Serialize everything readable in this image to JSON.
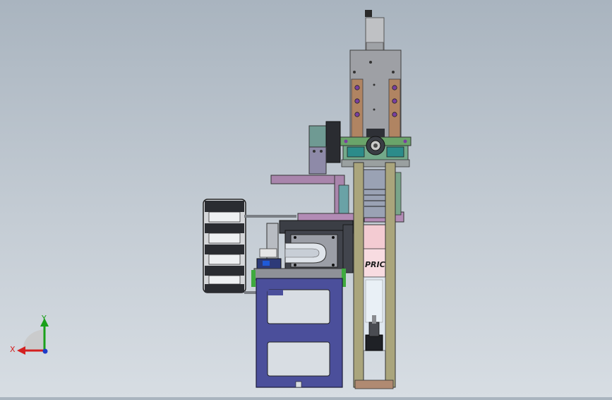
{
  "viewport": {
    "background_top": "#a9b4bf",
    "background_bottom": "#d7dde3"
  },
  "model": {
    "label_text": "PRICI"
  },
  "triad": {
    "x_label": "X",
    "y_label": "Y",
    "x_color": "#d42020",
    "y_color": "#1aa01a",
    "z_color": "#1e3cc8"
  },
  "colors": {
    "frame_blue": "#4a4f9a",
    "column_olive": "#a9a47b",
    "plate_grey": "#9a9ca2",
    "bracket_purple": "#a583aa",
    "block_pink": "#f0c8cf",
    "motor_dark": "#3a3d44",
    "bronze": "#a17a58",
    "accent_green": "#5fa25e"
  }
}
